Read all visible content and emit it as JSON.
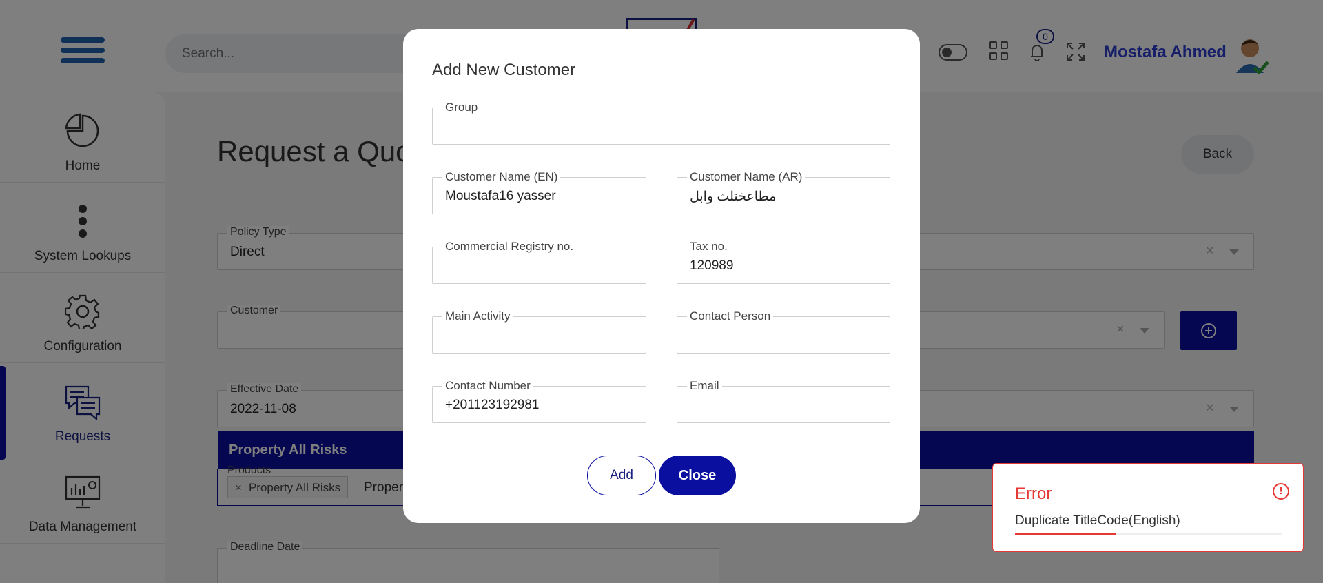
{
  "header": {
    "search_placeholder": "Search...",
    "notifications_count": "0",
    "user_name": "Mostafa Ahmed"
  },
  "sidebar": {
    "items": [
      {
        "label": "Home",
        "icon": "pie-chart-icon",
        "active": false
      },
      {
        "label": "System Lookups",
        "icon": "more-vertical-icon",
        "active": false
      },
      {
        "label": "Configuration",
        "icon": "gear-icon",
        "active": false
      },
      {
        "label": "Requests",
        "icon": "chat-bubbles-icon",
        "active": true
      },
      {
        "label": "Data Management",
        "icon": "monitor-chart-icon",
        "active": false
      }
    ]
  },
  "page": {
    "title": "Request a Quo",
    "back_label": "Back",
    "fields": {
      "policy_type": {
        "label": "Policy Type",
        "value": "Direct"
      },
      "customer": {
        "label": "Customer",
        "value": ""
      },
      "effective_date": {
        "label": "Effective Date",
        "value": "2022-11-08"
      },
      "products": {
        "label": "Products",
        "chip": "Property All Risks",
        "typed": "Proper"
      },
      "deadline_date": {
        "label": "Deadline Date",
        "value": ""
      }
    },
    "dropdown_option": "Property All Risks"
  },
  "modal": {
    "title": "Add New Customer",
    "fields": {
      "group": {
        "label": "Group",
        "value": ""
      },
      "customer_name_en": {
        "label": "Customer Name (EN)",
        "value": "Moustafa16 yasser"
      },
      "customer_name_ar": {
        "label": "Customer Name (AR)",
        "value": "مطاعخنلث وابل"
      },
      "commercial_registry": {
        "label": "Commercial Registry no.",
        "value": ""
      },
      "tax_no": {
        "label": "Tax no.",
        "value": "120989"
      },
      "main_activity": {
        "label": "Main Activity",
        "value": ""
      },
      "contact_person": {
        "label": "Contact Person",
        "value": ""
      },
      "contact_number": {
        "label": "Contact Number",
        "value": "+201123192981"
      },
      "email": {
        "label": "Email",
        "value": ""
      }
    },
    "add_label": "Add",
    "close_label": "Close"
  },
  "toast": {
    "title": "Error",
    "message": "Duplicate TitleCode(English)",
    "progress": 0.38,
    "color": "#e53935"
  },
  "colors": {
    "primary": "#0a0fa0",
    "user_name": "#2f3fd1",
    "error": "#e53935"
  }
}
